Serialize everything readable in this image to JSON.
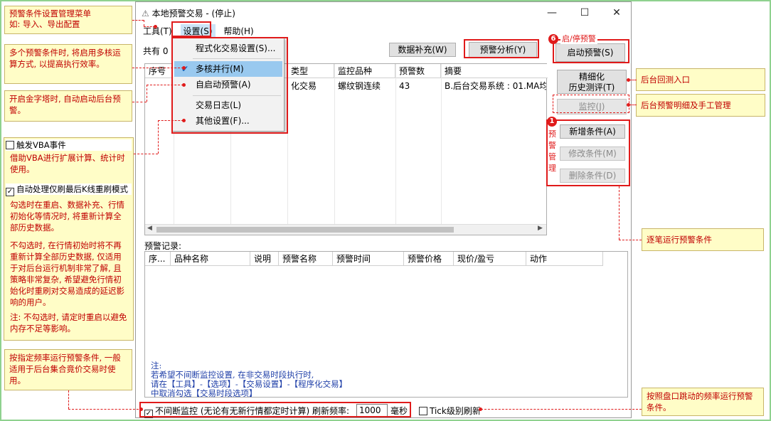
{
  "window": {
    "title": "本地预警交易  -  (停止)",
    "min": "—",
    "max": "☐",
    "close": "✕"
  },
  "menubar": [
    "工具(T)",
    "设置(S)",
    "帮助(H)"
  ],
  "toolbar": {
    "count_label": "共有 0",
    "supplement": "数据补充(W)",
    "analysis": "预警分析(Y)",
    "start": "启动预警(S)"
  },
  "side_buttons": {
    "refine": "精细化",
    "refine2": "历史测评(T)",
    "monitor": "监控(J)",
    "add": "新增条件(A)",
    "edit": "修改条件(M)",
    "del": "删除条件(D)"
  },
  "settings_menu": {
    "items": [
      "程式化交易设置(S)...",
      "多核并行(M)",
      "自启动预警(A)",
      "交易日志(L)",
      "其他设置(F)..."
    ],
    "checked": "✔"
  },
  "cond_table": {
    "headers": [
      "序号",
      "",
      "",
      "类型",
      "监控品种",
      "预警数",
      "摘要"
    ],
    "row": [
      "",
      "",
      "",
      "化交易",
      "螺纹钢连续",
      "43",
      "B.后台交易系统 : 01.MA均"
    ]
  },
  "records": {
    "label": "预警记录:",
    "headers": [
      "序...",
      "品种名称",
      "说明",
      "预警名称",
      "预警时间",
      "预警价格",
      "现价/盈亏",
      "动作"
    ],
    "notes": [
      "注:",
      "若希望不间断监控设置, 在非交易时段执行时,",
      "请在【工具】-【选项】-【交易设置】-【程序化交易】",
      "中取消勾选【交易时段选项】"
    ]
  },
  "bottom": {
    "continuous": "不间断监控 (无论有无新行情都定时计算) 刷新频率:",
    "freq": "1000",
    "unit": "毫秒",
    "tick": "Tick级别刷新"
  },
  "left_panel": {
    "vba_label": "触发VBA事件",
    "vba_desc": "借助VBA进行扩展计算、统计时使用。",
    "auto_label": "自动处理仅刷最后K线重刷模式",
    "auto_desc1": "勾选时在重启、数据补充、行情初始化等情况时, 将重新计算全部历史数据。",
    "auto_desc2": "不勾选时, 在行情初始时将不再重新计算全部历史数据, 仅适用于对后台运行机制非常了解, 且策略非常复杂, 希望避免行情初始化时重刷对交易造成的延迟影响的用户。",
    "auto_desc3": "注: 不勾选时, 请定时重启以避免内存不足等影响。"
  },
  "callouts": {
    "menu_mgmt": "预警条件设置管理菜单\n如: 导入、导出配置",
    "multicore": "多个预警条件时, 将启用多核运算方式, 以提高执行效率。",
    "autostart": "开启金字塔时, 自动启动后台预警。",
    "frequency": "按指定频率运行预警条件, 一般适用于后台集合竟价交易时使用。",
    "backtest": "后台回测入口",
    "detail": "后台预警明细及手工管理",
    "bystrip": "逐笔运行预警条件",
    "tickfreq": "按照盘口跳动的频率运行预警条件。",
    "start_label": "启/停预警",
    "mgmt_label": "预警管理",
    "badge1": "1",
    "badge6": "6"
  },
  "colors": {
    "accent_red": "#e01b1b",
    "note_blue": "#1f3fa8",
    "callout_bg": "#fffdc7",
    "highlight": "#99c9ef"
  }
}
